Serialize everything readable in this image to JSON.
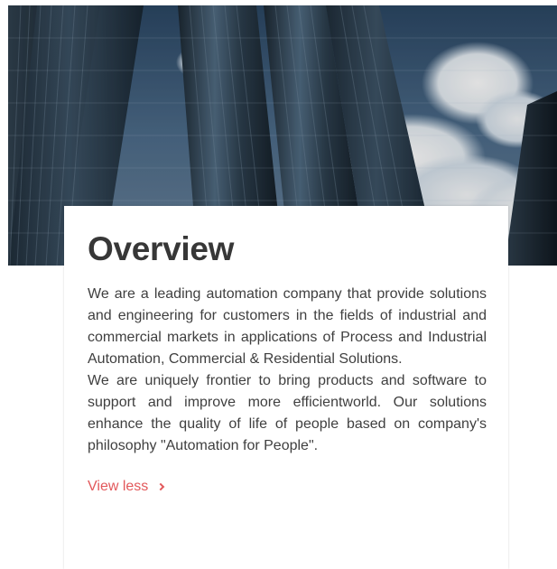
{
  "overview": {
    "title": "Overview",
    "paragraphs": [
      "We are a leading automation company that provide solutions and engineering for customers in the fields of industrial and commercial markets in applications of Process and Industrial Automation, Commercial & Residential Solutions.",
      "We are uniquely frontier to bring products and software to support and improve more efficientworld. Our solutions enhance the quality of life of people based on company's philosophy \"Automation for People\"."
    ],
    "view_less_label": "View less",
    "link_icon": "chevron-right-icon",
    "colors": {
      "accent": "#e2585b",
      "title": "#373737",
      "text": "#3f3f3f"
    }
  }
}
